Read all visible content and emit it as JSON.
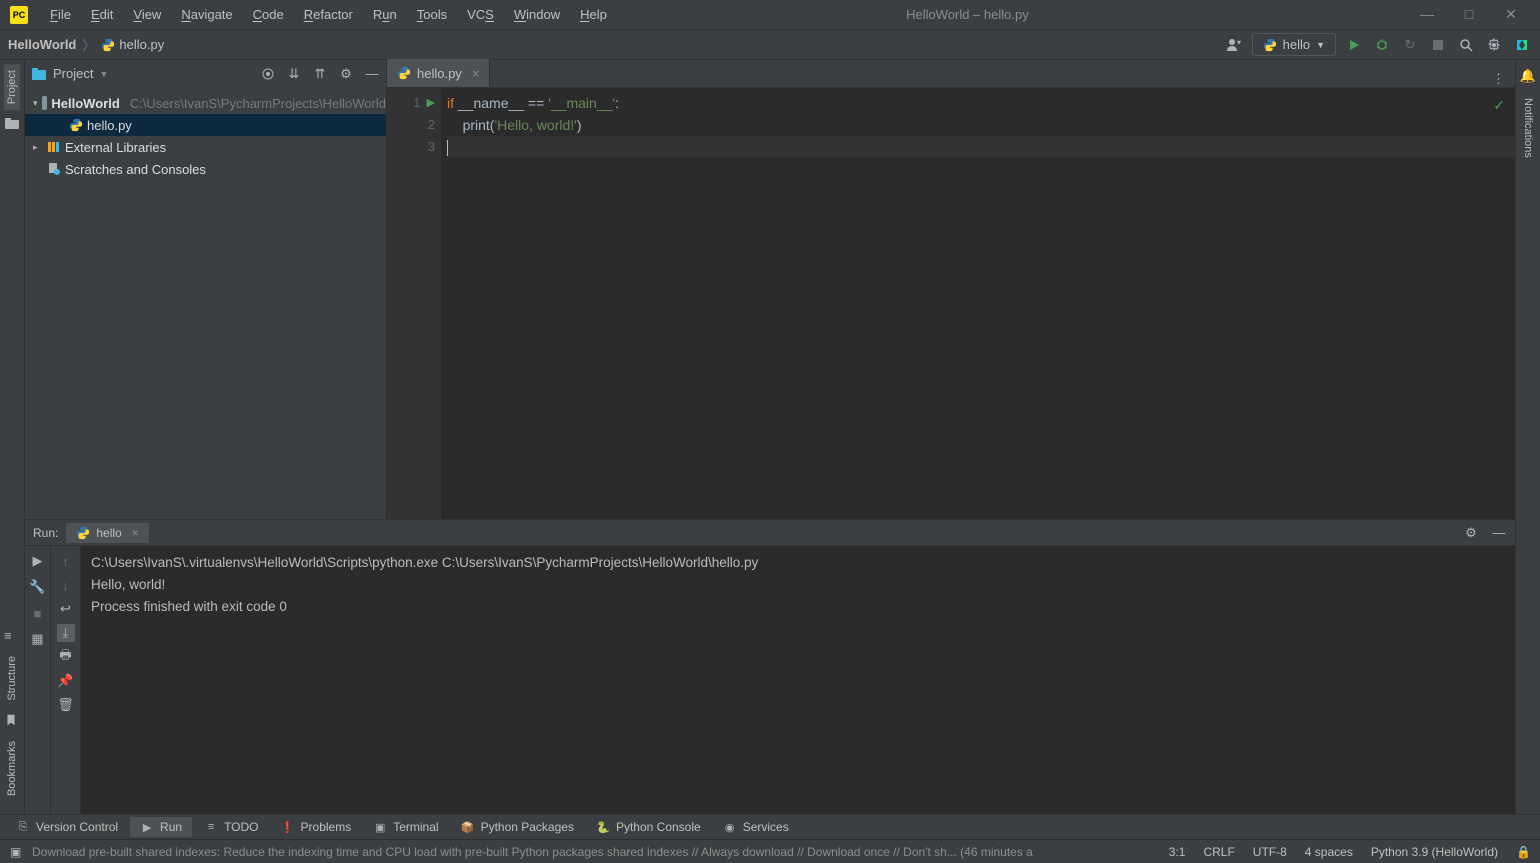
{
  "menu": [
    "File",
    "Edit",
    "View",
    "Navigate",
    "Code",
    "Refactor",
    "Run",
    "Tools",
    "VCS",
    "Window",
    "Help"
  ],
  "window_title": "HelloWorld – hello.py",
  "breadcrumb": {
    "project": "HelloWorld",
    "file": "hello.py"
  },
  "run_config": "hello",
  "project_tool": {
    "title": "Project",
    "root": {
      "name": "HelloWorld",
      "path": "C:\\Users\\IvanS\\PycharmProjects\\HelloWorld"
    },
    "file": "hello.py",
    "ext_lib": "External Libraries",
    "scratches": "Scratches and Consoles"
  },
  "tab": "hello.py",
  "gutter_lines": [
    "1",
    "2",
    "3"
  ],
  "code": {
    "l1_kw": "if",
    "l1_name": " __name__ ",
    "l1_eq": "== ",
    "l1_main": "'__main__'",
    "l1_colon": ":",
    "l2_fn": "print",
    "l2_open": "(",
    "l2_str": "'Hello, world!'",
    "l2_close": ")"
  },
  "run_panel": {
    "label": "Run:",
    "tab": "hello",
    "out1": "C:\\Users\\IvanS\\.virtualenvs\\HelloWorld\\Scripts\\python.exe C:\\Users\\IvanS\\PycharmProjects\\HelloWorld\\hello.py",
    "out2": "Hello, world!",
    "out3": "",
    "out4": "Process finished with exit code 0"
  },
  "bottom_tabs": {
    "vcs": "Version Control",
    "run": "Run",
    "todo": "TODO",
    "problems": "Problems",
    "terminal": "Terminal",
    "pkgs": "Python Packages",
    "pycon": "Python Console",
    "services": "Services"
  },
  "status": {
    "msg": "Download pre-built shared indexes: Reduce the indexing time and CPU load with pre-built Python packages shared indexes // Always download // Download once // Don't sh... (46 minutes a",
    "pos": "3:1",
    "le": "CRLF",
    "enc": "UTF-8",
    "indent": "4 spaces",
    "sdk": "Python 3.9 (HelloWorld)"
  },
  "side_tabs": {
    "project": "Project",
    "structure": "Structure",
    "bookmarks": "Bookmarks",
    "notifications": "Notifications"
  }
}
